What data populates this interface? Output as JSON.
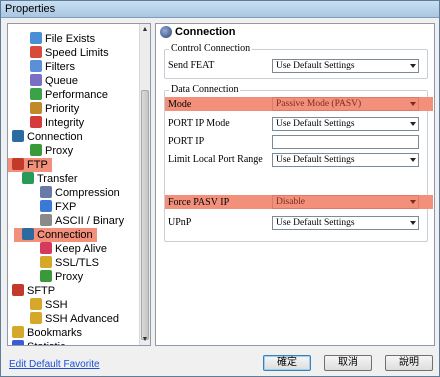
{
  "window": {
    "title": "Properties"
  },
  "tree": {
    "items": [
      {
        "label": "File Exists",
        "icon": "file-exists-icon",
        "color": "#4a8fd6"
      },
      {
        "label": "Speed Limits",
        "icon": "speed-limits-icon",
        "color": "#d84a3a"
      },
      {
        "label": "Filters",
        "icon": "filters-icon",
        "color": "#5b8fd8"
      },
      {
        "label": "Queue",
        "icon": "queue-icon",
        "color": "#7a6fc2"
      },
      {
        "label": "Performance",
        "icon": "performance-icon",
        "color": "#3aa34a"
      },
      {
        "label": "Priority",
        "icon": "priority-icon",
        "color": "#c08a2a"
      },
      {
        "label": "Integrity",
        "icon": "integrity-icon",
        "color": "#d63a3a"
      },
      {
        "label": "Connection",
        "icon": "connection-icon",
        "color": "#2d6a9f"
      },
      {
        "label": "Proxy",
        "icon": "proxy-icon",
        "color": "#3a9a3a"
      },
      {
        "label": "FTP",
        "icon": "ftp-icon",
        "color": "#c23a2a"
      },
      {
        "label": "Transfer",
        "icon": "transfer-icon",
        "color": "#2a9a5a"
      },
      {
        "label": "Compression",
        "icon": "compression-icon",
        "color": "#6a7aa8"
      },
      {
        "label": "FXP",
        "icon": "fxp-icon",
        "color": "#3a7ad6"
      },
      {
        "label": "ASCII / Binary",
        "icon": "ascii-binary-icon",
        "color": "#8a8a8a"
      },
      {
        "label": "Connection",
        "icon": "connection-icon",
        "color": "#2d6a9f"
      },
      {
        "label": "Keep Alive",
        "icon": "keep-alive-icon",
        "color": "#d63a5a"
      },
      {
        "label": "SSL/TLS",
        "icon": "ssl-tls-icon",
        "color": "#d6a82a"
      },
      {
        "label": "Proxy",
        "icon": "proxy-icon",
        "color": "#3a9a3a"
      },
      {
        "label": "SFTP",
        "icon": "sftp-icon",
        "color": "#c23a2a"
      },
      {
        "label": "SSH",
        "icon": "ssh-icon",
        "color": "#d6a82a"
      },
      {
        "label": "SSH Advanced",
        "icon": "ssh-advanced-icon",
        "color": "#d6a82a"
      },
      {
        "label": "Bookmarks",
        "icon": "bookmarks-icon",
        "color": "#d6a82a"
      },
      {
        "label": "Statistic",
        "icon": "statistic-icon",
        "color": "#3a5ad6"
      }
    ]
  },
  "panel": {
    "title": "Connection",
    "control_group": "Control Connection",
    "data_group": "Data Connection",
    "rows": {
      "send_feat": {
        "label": "Send FEAT",
        "value": "Use Default Settings"
      },
      "mode": {
        "label": "Mode",
        "value": "Passive Mode (PASV)"
      },
      "port_ip_mode": {
        "label": "PORT IP Mode",
        "value": "Use Default Settings"
      },
      "port_ip": {
        "label": "PORT IP",
        "value": ""
      },
      "limit_port_range": {
        "label": "Limit Local Port Range",
        "value": "Use Default Settings"
      },
      "force_pasv_ip": {
        "label": "Force PASV IP",
        "value": "Disable"
      },
      "upnp": {
        "label": "UPnP",
        "value": "Use Default Settings"
      }
    }
  },
  "footer": {
    "link": "Edit Default Favorite",
    "ok": "確定",
    "cancel": "取消",
    "help": "說明"
  },
  "colors": {
    "highlight": "#f3907c",
    "link": "#1a4fd6"
  }
}
